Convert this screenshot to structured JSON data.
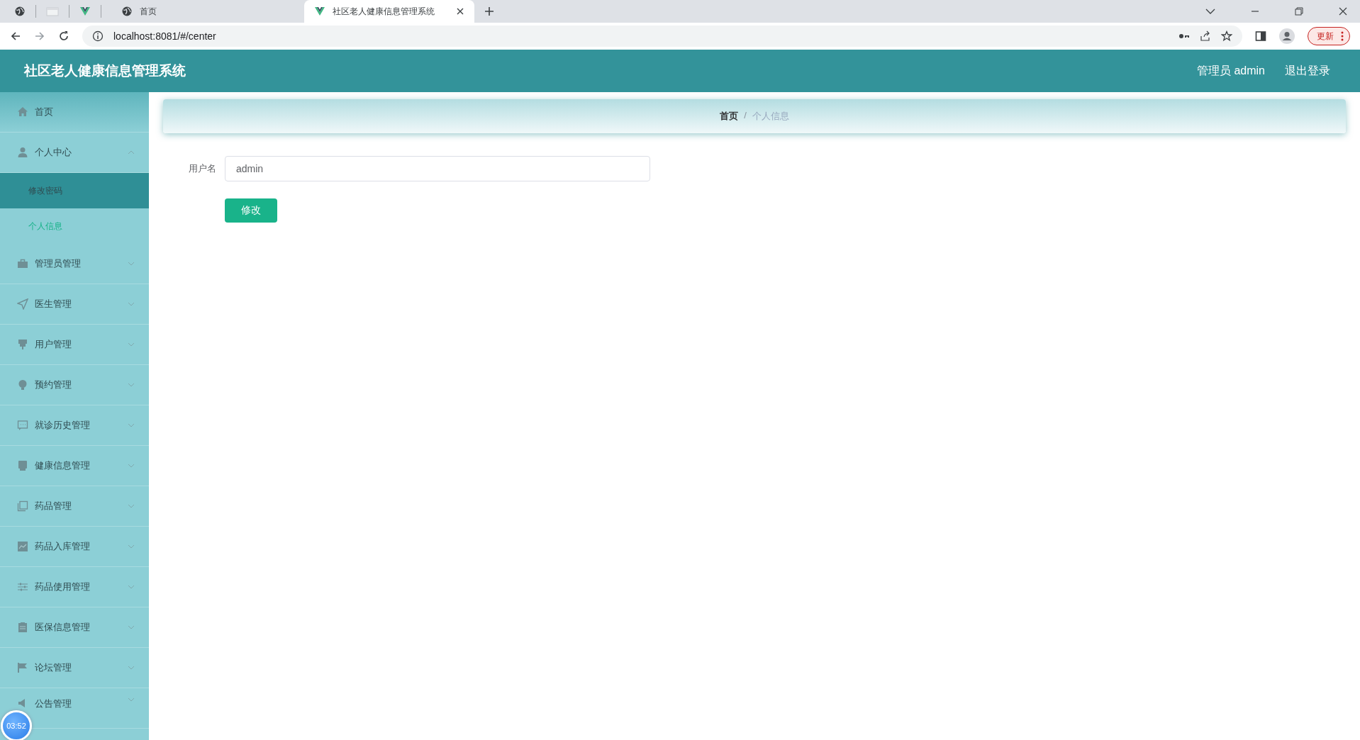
{
  "browser": {
    "tabs": [
      {
        "label": "首页",
        "selected": false
      },
      {
        "label": "社区老人健康信息管理系统",
        "selected": true
      }
    ],
    "address": "localhost:8081/#/center",
    "update_button": "更新"
  },
  "header": {
    "title": "社区老人健康信息管理系统",
    "user": "管理员 admin",
    "logout": "退出登录"
  },
  "sidebar": {
    "items": [
      {
        "kind": "link",
        "label": "首页"
      },
      {
        "kind": "group",
        "label": "个人中心",
        "expanded": true,
        "children": [
          {
            "label": "修改密码",
            "highlighted": true,
            "selected": false
          },
          {
            "label": "个人信息",
            "highlighted": false,
            "selected": true
          }
        ]
      },
      {
        "kind": "group",
        "label": "管理员管理",
        "expanded": false
      },
      {
        "kind": "group",
        "label": "医生管理",
        "expanded": false
      },
      {
        "kind": "group",
        "label": "用户管理",
        "expanded": false
      },
      {
        "kind": "group",
        "label": "预约管理",
        "expanded": false
      },
      {
        "kind": "group",
        "label": "就诊历史管理",
        "expanded": false
      },
      {
        "kind": "group",
        "label": "健康信息管理",
        "expanded": false
      },
      {
        "kind": "group",
        "label": "药品管理",
        "expanded": false
      },
      {
        "kind": "group",
        "label": "药品入库管理",
        "expanded": false
      },
      {
        "kind": "group",
        "label": "药品使用管理",
        "expanded": false
      },
      {
        "kind": "group",
        "label": "医保信息管理",
        "expanded": false
      },
      {
        "kind": "group",
        "label": "论坛管理",
        "expanded": false
      },
      {
        "kind": "group",
        "label": "公告管理",
        "expanded": false
      }
    ]
  },
  "breadcrumb": [
    "首页",
    "个人信息"
  ],
  "breadcrumb_separator": "/",
  "form": {
    "fields": [
      {
        "label": "用户名",
        "value": "admin"
      }
    ],
    "submit": "修改"
  },
  "recorder_badge": "03:52"
}
